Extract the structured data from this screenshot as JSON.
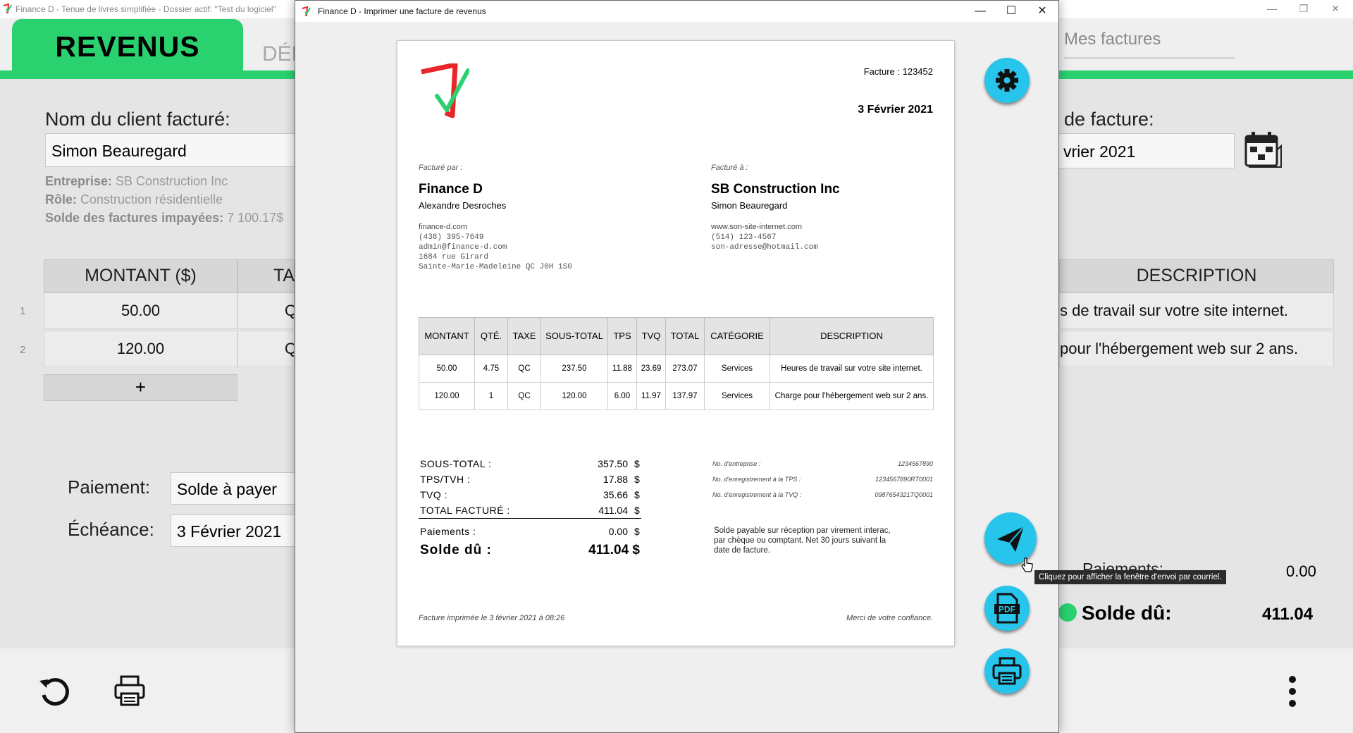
{
  "background": {
    "window_title": "Finance D - Tenue de livres simplifiée - Dossier actif: \"Test du logiciel\"",
    "tabs": {
      "revenus": "REVENUS",
      "depenses_partial": "DÉP",
      "factures": "Mes factures"
    },
    "client_label": "Nom du client facturé:",
    "client_value": "Simon Beauregard",
    "info": {
      "entreprise_label": "Entreprise:",
      "entreprise_value": "SB Construction Inc",
      "role_label": "Rôle:",
      "role_value": "Construction résidentielle",
      "solde_label": "Solde des factures impayées:",
      "solde_value": "7 100.17$"
    },
    "grid_headers": {
      "montant": "MONTANT ($)",
      "taxe_partial": "TA",
      "description": "DESCRIPTION"
    },
    "grid_rows": [
      {
        "num": "1",
        "montant": "50.00",
        "taxe": "Q",
        "description": "s de travail sur votre site internet."
      },
      {
        "num": "2",
        "montant": "120.00",
        "taxe": "Q",
        "description": "pour l'hébergement web sur 2 ans."
      }
    ],
    "add_row": "+",
    "paiement_label": "Paiement:",
    "paiement_value": "Solde à payer",
    "echeance_label": "Échéance:",
    "echeance_value": "3 Février 2021",
    "date_label_partial": "de facture:",
    "date_value_partial": "vrier 2021",
    "paiements_partial": "Paiements:",
    "paiements_value": "0.00",
    "solde_du_label": "Solde dû:",
    "solde_du_value": "411.04"
  },
  "dialog": {
    "title": "Finance D - Imprimer une facture de revenus",
    "controls": {
      "minimize": "—",
      "maximize": "☐",
      "close": "✕"
    }
  },
  "invoice": {
    "number_label": "Facture : 123452",
    "date": "3 Février 2021",
    "from": {
      "label": "Facturé par :",
      "company": "Finance D",
      "person": "Alexandre Desroches",
      "lines": [
        "finance-d.com",
        "(438) 395-7649",
        "admin@finance-d.com",
        "1684 rue Girard",
        "Sainte-Marie-Madeleine QC  J0H 1S0"
      ]
    },
    "to": {
      "label": "Facturé à :",
      "company": "SB Construction Inc",
      "person": "Simon Beauregard",
      "lines": [
        "www.son-site-internet.com",
        "(514) 123-4567",
        "son-adresse@hotmail.com"
      ]
    },
    "table_headers": [
      "MONTANT",
      "QTÉ.",
      "TAXE",
      "SOUS-TOTAL",
      "TPS",
      "TVQ",
      "TOTAL",
      "CATÉGORIE",
      "DESCRIPTION"
    ],
    "table_rows": [
      [
        "50.00",
        "4.75",
        "QC",
        "237.50",
        "11.88",
        "23.69",
        "273.07",
        "Services",
        "Heures de travail sur votre site internet."
      ],
      [
        "120.00",
        "1",
        "QC",
        "120.00",
        "6.00",
        "11.97",
        "137.97",
        "Services",
        "Charge pour l'hébergement web sur 2 ans."
      ]
    ],
    "totals": {
      "sous_total_label": "SOUS-TOTAL :",
      "sous_total": "357.50",
      "tps_label": "TPS/TVH :",
      "tps": "17.88",
      "tvq_label": "TVQ :",
      "tvq": "35.66",
      "total_label": "TOTAL FACTURÉ :",
      "total": "411.04",
      "paiements_label": "Paiements :",
      "paiements": "0.00",
      "solde_label": "Solde dû :",
      "solde": "411.04 $",
      "currency": "$"
    },
    "registration": [
      {
        "label": "No. d'entreprise :",
        "value": "1234567890"
      },
      {
        "label": "No. d'enregistrement à la TPS :",
        "value": "1234567890RT0001"
      },
      {
        "label": "No. d'enregistrement à la TVQ :",
        "value": "0987654321TQ0001"
      }
    ],
    "terms": [
      "Solde payable sur réception par virement interac,",
      "par chèque ou comptant. Net 30 jours suivant la",
      "date de facture."
    ],
    "footer_left": "Facture imprimée le 3 février 2021 à 08:26",
    "footer_right": "Merci de votre confiance."
  },
  "tooltip": "Cliquez pour afficher la fenêtre d'envoi par courriel.",
  "icons": [
    "gear-icon",
    "send-icon",
    "pdf-icon",
    "printer-icon",
    "undo-icon",
    "more-icon",
    "calendar-icon",
    "logo-icon"
  ],
  "colors": {
    "brand_green": "#2ad16f",
    "fab_blue": "#27c4ec",
    "logo_red": "#e8262a",
    "logo_green": "#2ad16f"
  }
}
